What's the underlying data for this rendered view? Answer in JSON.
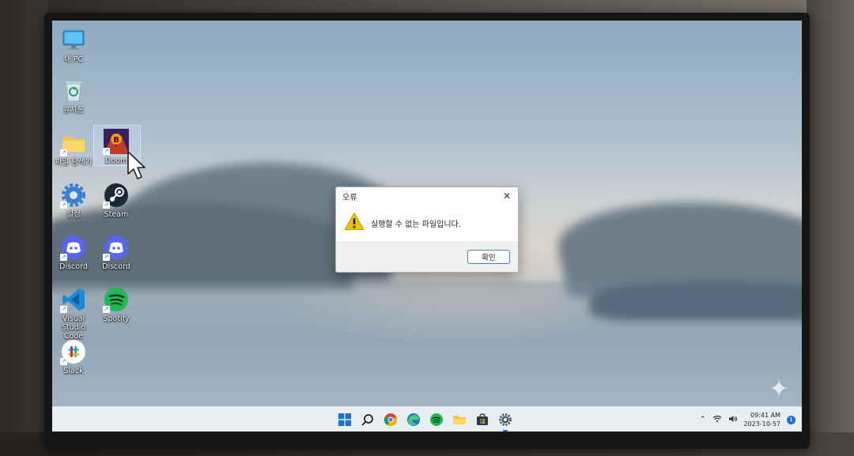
{
  "desktop": {
    "icons": [
      {
        "label": "내 PC",
        "icon": "monitor-icon"
      },
      {
        "label": "휴지통",
        "icon": "recycle-bin-icon"
      },
      {
        "label": "파일 탐색기",
        "icon": "folder-icon"
      },
      {
        "label": "Doom",
        "icon": "doom-game-icon"
      },
      {
        "label": "설정",
        "icon": "gear-icon"
      },
      {
        "label": "Steam",
        "icon": "steam-icon"
      },
      {
        "label": "Discord",
        "icon": "discord-icon"
      },
      {
        "label": "Discord",
        "icon": "discord-icon"
      },
      {
        "label": "Visual Studio Code",
        "icon": "vscode-icon"
      },
      {
        "label": "Spotify",
        "icon": "spotify-icon"
      },
      {
        "label": "Slack",
        "icon": "slack-icon"
      }
    ]
  },
  "dialog": {
    "title": "오류",
    "message": "실행할 수 없는 파일입니다.",
    "ok_label": "확인"
  },
  "taskbar": {
    "apps": [
      "windows-start-icon",
      "search-icon",
      "chrome-icon",
      "edge-icon",
      "spotify-icon",
      "file-explorer-icon",
      "store-icon",
      "settings-icon"
    ],
    "clock_time": "09:41 AM",
    "clock_date": "2023-10-57",
    "notifications": "1"
  },
  "colors": {
    "accent": "#1d6fd8",
    "warning": "#f2c200",
    "discord": "#5865f2",
    "spotify": "#1db954",
    "steam": "#1b2838"
  }
}
